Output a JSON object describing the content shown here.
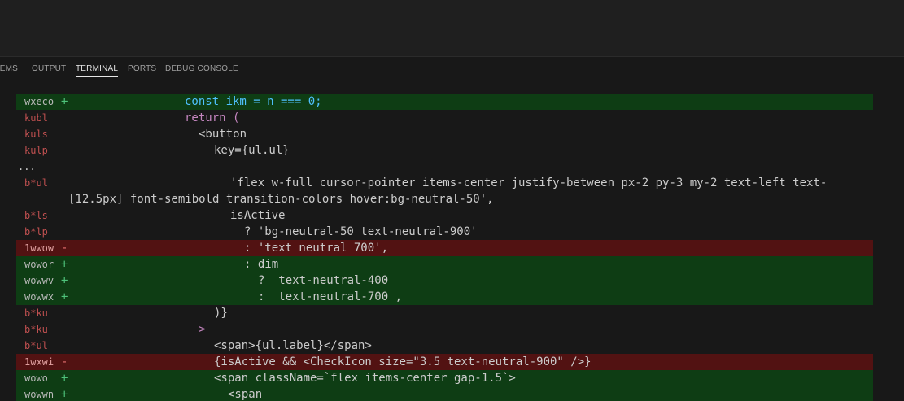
{
  "panel": {
    "tabs": [
      {
        "label": "LEMS",
        "active": false
      },
      {
        "label": "OUTPUT",
        "active": false
      },
      {
        "label": "TERMINAL",
        "active": true
      },
      {
        "label": "PORTS",
        "active": false
      },
      {
        "label": "DEBUG CONSOLE",
        "active": false
      }
    ]
  },
  "colors": {
    "added_bg": "#0e3d14",
    "removed_bg": "#521212",
    "panel_bg": "#181818",
    "active_tab": "#e7e7e7"
  },
  "terminal": {
    "lines": [
      {
        "type": "added",
        "num": "wxeco",
        "sign": "+",
        "code": "const ikm = n === 0;"
      },
      {
        "type": "context",
        "num": "kubl",
        "sign": "",
        "code": "return ("
      },
      {
        "type": "context",
        "num": "kuls",
        "sign": "",
        "code": "<button"
      },
      {
        "type": "context",
        "num": "kulp",
        "sign": "",
        "code": "key={ul.ul}"
      },
      {
        "type": "ellipsis",
        "num": "...",
        "sign": "",
        "code": ""
      },
      {
        "type": "context",
        "num": "b*ul",
        "sign": "",
        "code": "'flex w-full cursor-pointer items-center justify-between px-2 py-3 my-2 text-left text-"
      },
      {
        "type": "wrap",
        "num": "",
        "sign": "",
        "code": "[12.5px] font-semibold transition-colors hover:bg-neutral-50',"
      },
      {
        "type": "context",
        "num": "b*ls",
        "sign": "",
        "code": "isActive"
      },
      {
        "type": "context",
        "num": "b*lp",
        "sign": "",
        "code": "? 'bg-neutral-50 text-neutral-900'"
      },
      {
        "type": "removed",
        "num": "1wwow",
        "sign": "-",
        "code": ": 'text neutral 700',"
      },
      {
        "type": "added",
        "num": "wowor",
        "sign": "+",
        "code": ": dim"
      },
      {
        "type": "added",
        "num": "wowwv",
        "sign": "+",
        "code": "?  text-neutral-400"
      },
      {
        "type": "added",
        "num": "wowwx",
        "sign": "+",
        "code": ":  text-neutral-700 ,"
      },
      {
        "type": "context",
        "num": "b*ku",
        "sign": "",
        "code": ")}"
      },
      {
        "type": "context",
        "num": "b*ku",
        "sign": "",
        "code": ">"
      },
      {
        "type": "context",
        "num": "b*ul",
        "sign": "",
        "code": "<span>{ul.label}</span>"
      },
      {
        "type": "removed",
        "num": "1wxwi",
        "sign": "-",
        "code": "{isActive && <CheckIcon size=\"3.5 text-neutral-900\" />}"
      },
      {
        "type": "added",
        "num": "wowo",
        "sign": "+",
        "code": "<span className=`flex items-center gap-1.5`>"
      },
      {
        "type": "added",
        "num": "wowwn",
        "sign": "+",
        "code": "<span"
      }
    ]
  }
}
